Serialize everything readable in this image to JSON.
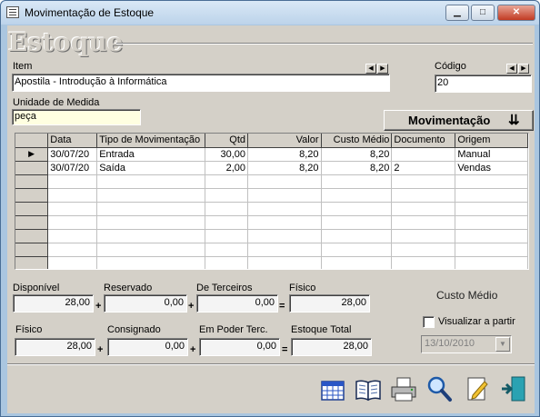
{
  "window": {
    "title": "Movimentação de Estoque",
    "minimize_glyph": "▁",
    "maximize_glyph": "□",
    "close_glyph": "✕"
  },
  "brand": {
    "text": "Estoque"
  },
  "item": {
    "label": "Item",
    "value": "Apostila - Introdução à Informática",
    "prev_glyph": "◀",
    "next_glyph": "▶"
  },
  "codigo": {
    "label": "Código",
    "value": "20",
    "prev_glyph": "◀",
    "next_glyph": "▶"
  },
  "unidade": {
    "label": "Unidade de Medida",
    "value": "peça"
  },
  "movimentacao": {
    "label": "Movimentação",
    "icon_glyph": "⇊"
  },
  "grid": {
    "columns": [
      "Data",
      "Tipo de Movimentação",
      "Qtd",
      "Valor",
      "Custo Médio",
      "Documento",
      "Origem"
    ],
    "indicator_glyph": "▶",
    "rows": [
      {
        "data": "30/07/20",
        "tipo": "Entrada",
        "qtd": "30,00",
        "valor": "8,20",
        "custo": "8,20",
        "documento": "",
        "origem": "Manual"
      },
      {
        "data": "30/07/20",
        "tipo": "Saída",
        "qtd": "2,00",
        "valor": "8,20",
        "custo": "8,20",
        "documento": "2",
        "origem": "Vendas"
      }
    ]
  },
  "totals_row1": {
    "disponivel": {
      "label": "Disponível",
      "value": "28,00"
    },
    "reservado": {
      "label": "Reservado",
      "value": "0,00"
    },
    "terceiros": {
      "label": "De Terceiros",
      "value": "0,00"
    },
    "fisico": {
      "label": "Físico",
      "value": "28,00"
    },
    "op_plus1": "+",
    "op_plus2": "+",
    "op_eq": "="
  },
  "totals_row2": {
    "fisico": {
      "label": "Físico",
      "value": "28,00"
    },
    "consignado": {
      "label": "Consignado",
      "value": "0,00"
    },
    "poder_terc": {
      "label": "Em Poder Terc.",
      "value": "0,00"
    },
    "estoque_total": {
      "label": "Estoque Total",
      "value": "28,00"
    },
    "op_plus1": "+",
    "op_plus2": "+",
    "op_eq": "="
  },
  "custo_medio": {
    "title": "Custo Médio",
    "checkbox_label": "Visualizar a partir",
    "date_value": "13/10/2010",
    "drop_glyph": "▼"
  },
  "toolbar": {
    "icons": [
      "calendar-grid-icon",
      "book-icon",
      "printer-icon",
      "magnifier-icon",
      "edit-note-icon",
      "exit-door-icon"
    ]
  }
}
